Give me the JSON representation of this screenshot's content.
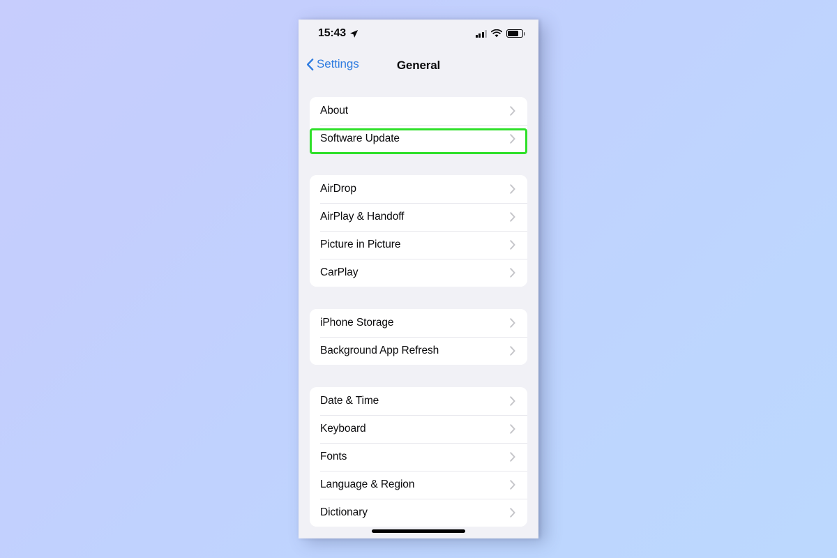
{
  "theme": {
    "accent_blue": "#2f7ce0",
    "highlight_green": "#2fe02a",
    "page_background": "#f1f1f6",
    "card_background": "#ffffff",
    "separator": "#e8e8ed",
    "text_primary": "#0b0b0d",
    "chevron_gray": "#c5c5c9",
    "wallpaper_from": "#c7cdfd",
    "wallpaper_to": "#bcd8fe"
  },
  "status_bar": {
    "time": "15:43",
    "location_icon": "location-arrow-icon",
    "cellular_icon": "signal-bars-icon",
    "cellular_bars_filled": 3,
    "cellular_bars_total": 4,
    "wifi_icon": "wifi-icon",
    "battery_icon": "battery-icon",
    "battery_level_percent": 67
  },
  "nav_bar": {
    "back_icon": "chevron-left-icon",
    "back_label": "Settings",
    "title": "General"
  },
  "groups": [
    {
      "id": "group-system",
      "rows": [
        {
          "label": "About",
          "chevron": "chevron-right-icon",
          "highlighted": false
        },
        {
          "label": "Software Update",
          "chevron": "chevron-right-icon",
          "highlighted": true
        }
      ]
    },
    {
      "id": "group-connectivity",
      "rows": [
        {
          "label": "AirDrop",
          "chevron": "chevron-right-icon",
          "highlighted": false
        },
        {
          "label": "AirPlay & Handoff",
          "chevron": "chevron-right-icon",
          "highlighted": false
        },
        {
          "label": "Picture in Picture",
          "chevron": "chevron-right-icon",
          "highlighted": false
        },
        {
          "label": "CarPlay",
          "chevron": "chevron-right-icon",
          "highlighted": false
        }
      ]
    },
    {
      "id": "group-storage",
      "rows": [
        {
          "label": "iPhone Storage",
          "chevron": "chevron-right-icon",
          "highlighted": false
        },
        {
          "label": "Background App Refresh",
          "chevron": "chevron-right-icon",
          "highlighted": false
        }
      ]
    },
    {
      "id": "group-localization",
      "rows": [
        {
          "label": "Date & Time",
          "chevron": "chevron-right-icon",
          "highlighted": false
        },
        {
          "label": "Keyboard",
          "chevron": "chevron-right-icon",
          "highlighted": false
        },
        {
          "label": "Fonts",
          "chevron": "chevron-right-icon",
          "highlighted": false
        },
        {
          "label": "Language & Region",
          "chevron": "chevron-right-icon",
          "highlighted": false
        },
        {
          "label": "Dictionary",
          "chevron": "chevron-right-icon",
          "highlighted": false
        }
      ]
    }
  ],
  "home_indicator": "home-indicator-bar"
}
